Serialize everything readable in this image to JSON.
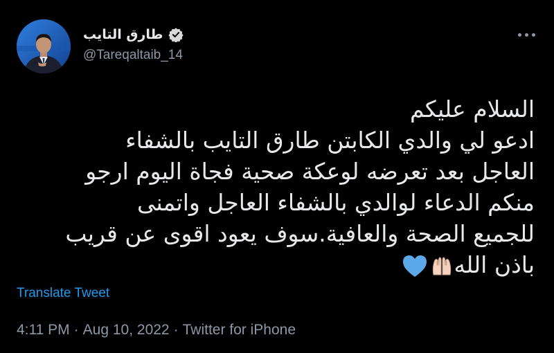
{
  "author": {
    "display_name": "طارق التايب",
    "handle": "@Tareqaltaib_14",
    "verified": true,
    "avatar_icon": "avatar-news-anchor"
  },
  "tweet": {
    "lines": [
      "السلام عليكم",
      "ادعو لي والدي الكابتن طارق التايب بالشفاء",
      "العاجل بعد تعرضه لوعكة صحية فجاة اليوم ارجو",
      "منكم الدعاء لوالدي بالشفاء العاجل واتمنى",
      "للجميع الصحة والعافية.سوف يعود اقوى عن قريب",
      "باذن الله"
    ],
    "emojis": [
      "raised-hands-emoji",
      "blue-heart-emoji"
    ],
    "translate_label": "Translate Tweet"
  },
  "meta": {
    "time": "4:11 PM",
    "date": "Aug 10, 2022",
    "source": "Twitter for iPhone",
    "separator": "·"
  },
  "colors": {
    "background": "#000000",
    "text": "#e7e9ea",
    "secondary": "#8b98a5",
    "accent": "#1d9bf0",
    "heart": "#5da8e8"
  }
}
